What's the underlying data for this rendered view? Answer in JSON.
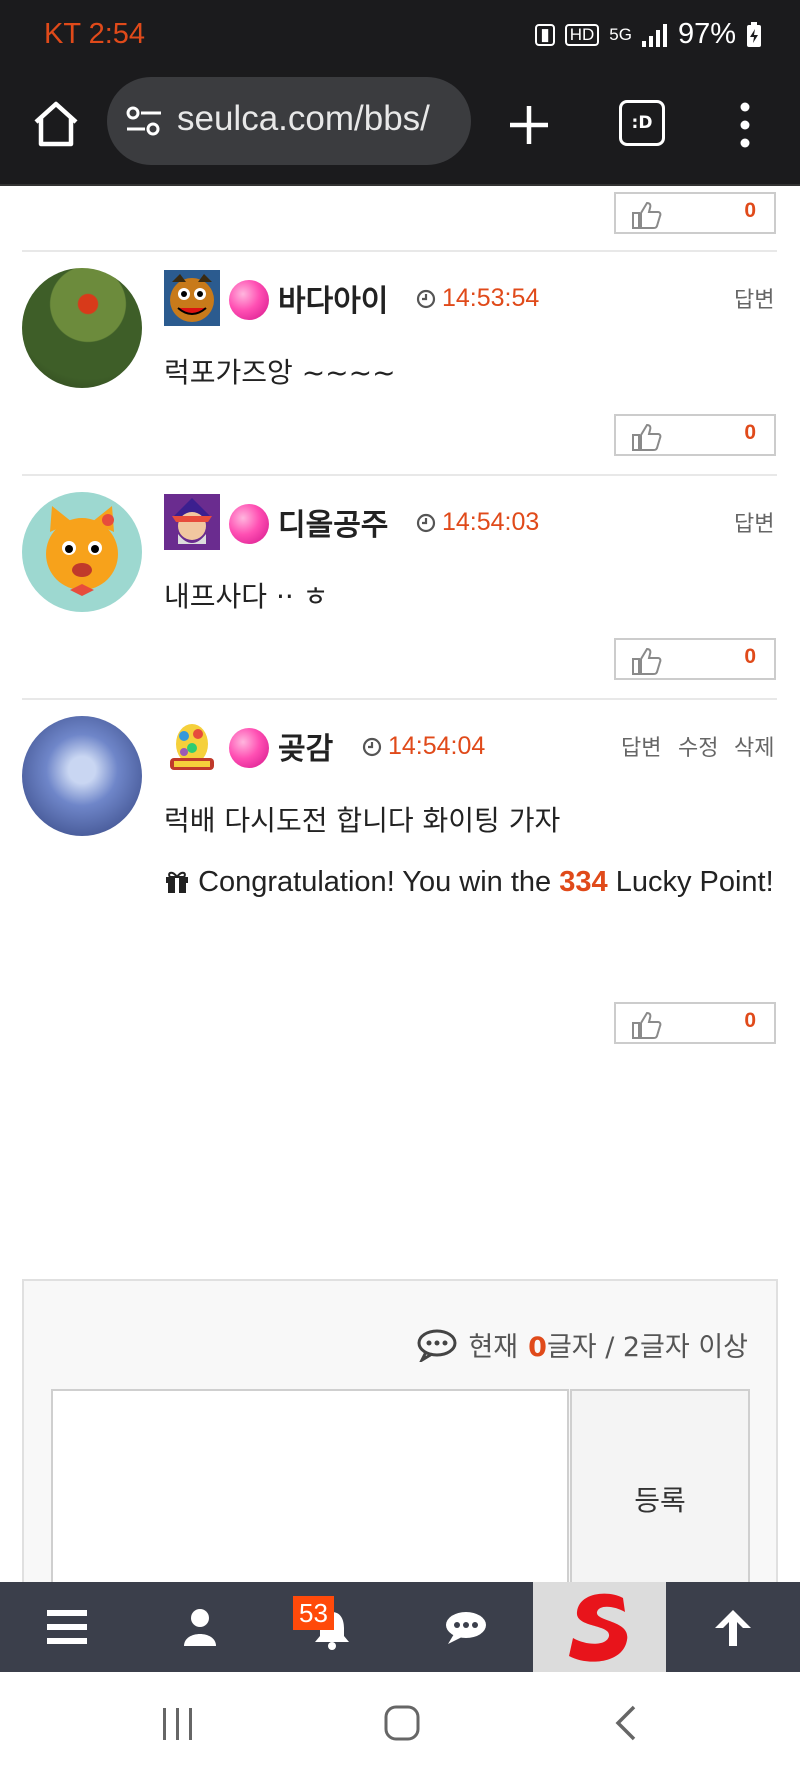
{
  "status_bar": {
    "carrier_time": "KT 2:54",
    "network": "5G",
    "battery": "97%"
  },
  "browser": {
    "url": "seulca.com/bbs/",
    "tabs_label": ":D"
  },
  "comments": [
    {
      "nick": "바다아이",
      "time": "14:53:54",
      "text": "럭포가즈앙 ~~~~",
      "reply": "답변",
      "likes": "0"
    },
    {
      "nick": "디올공주",
      "time": "14:54:03",
      "text": "내프사다 ·· ㅎ",
      "reply": "답변",
      "likes": "0"
    },
    {
      "nick": "곶감",
      "time": "14:54:04",
      "text": "럭배 다시도전 합니다  화이팅  가자",
      "reply": "답변",
      "edit": "수정",
      "delete": "삭제",
      "lucky_prefix": "Congratulation! You win the",
      "lucky_points": "334",
      "lucky_suffix": "Lucky Point!",
      "likes": "0"
    }
  ],
  "top_like_count": "0",
  "write": {
    "current_label": "현재",
    "count": "0",
    "count_suffix": "글자 / 2글자 이상",
    "submit": "등록"
  },
  "bottom_nav": {
    "notification_count": "53"
  },
  "colors": {
    "accent": "#e04a1a",
    "navbar": "#3b3f4b",
    "browser": "#1b1b1d"
  }
}
